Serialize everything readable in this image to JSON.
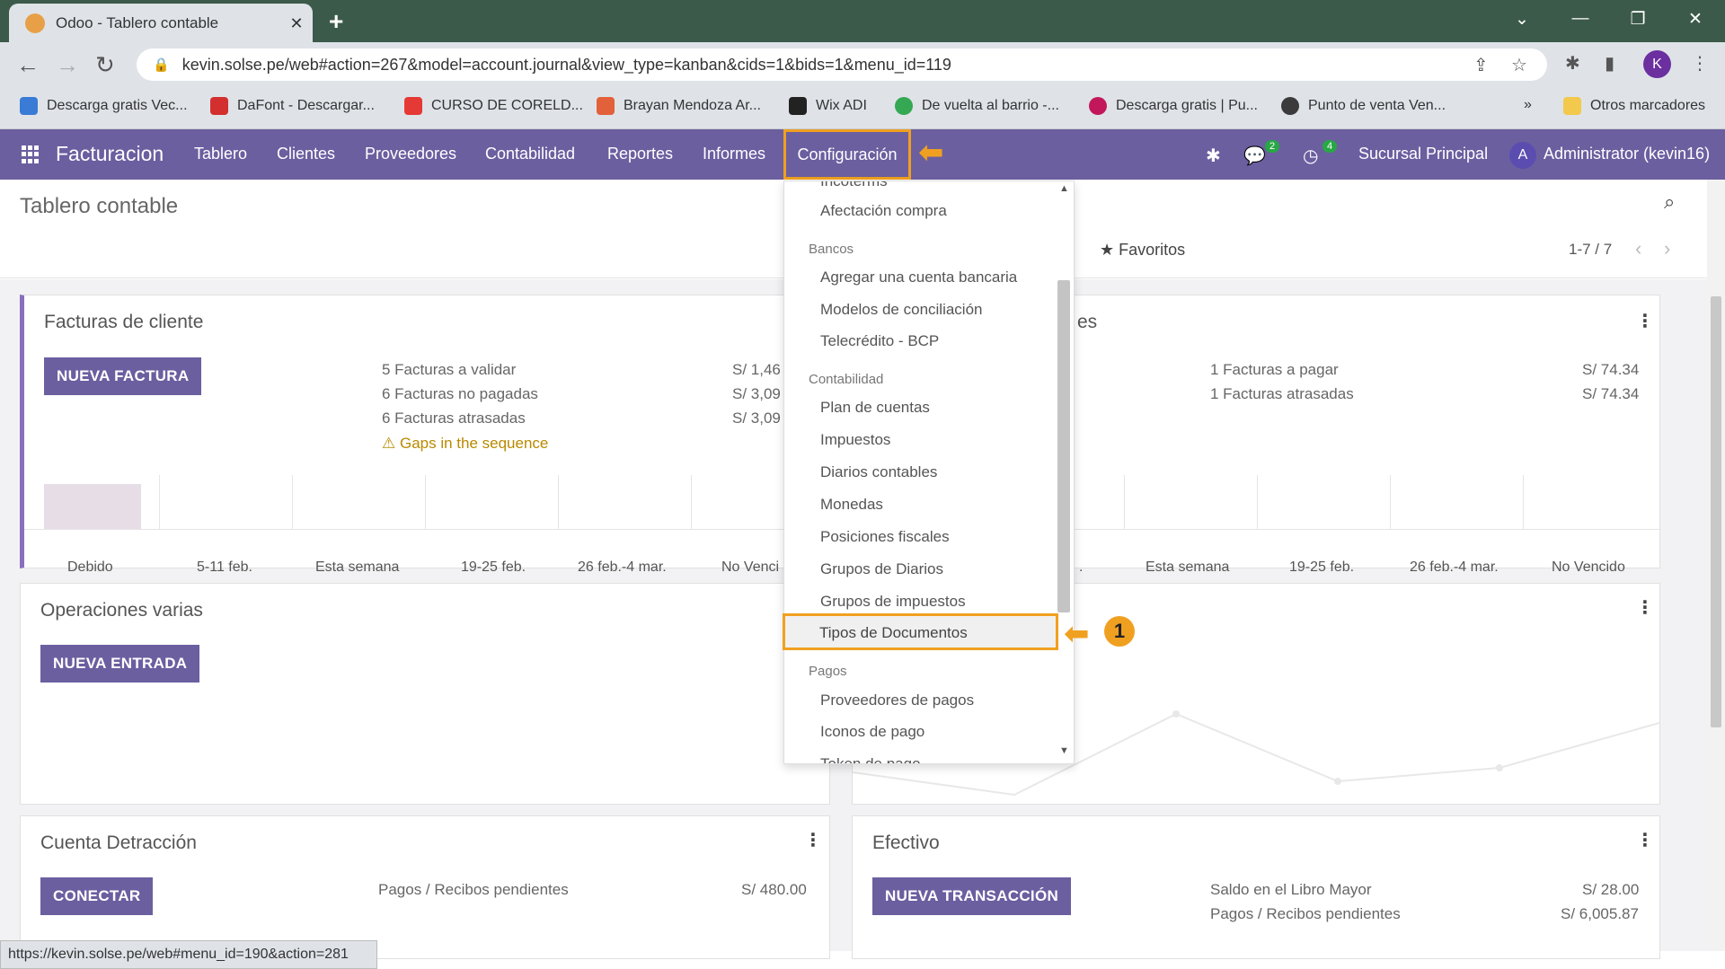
{
  "browser": {
    "tab_title": "Odoo - Tablero contable",
    "tab_close": "✕",
    "new_tab": "+",
    "url": "kevin.solse.pe/web#action=267&model=account.journal&view_type=kanban&cids=1&bids=1&menu_id=119",
    "profile_initial": "K",
    "bookmarks": [
      "Descarga gratis Vec...",
      "DaFont - Descargar...",
      "CURSO DE CORELD...",
      "Brayan Mendoza Ar...",
      "Wix ADI",
      "De vuelta al barrio -...",
      "Descarga gratis | Pu...",
      "Punto de venta Ven..."
    ],
    "bookmarks_more": "»",
    "other_bookmarks": "Otros marcadores",
    "status_url": "https://kevin.solse.pe/web#menu_id=190&action=281"
  },
  "topnav": {
    "brand": "Facturacion",
    "items": [
      "Tablero",
      "Clientes",
      "Proveedores",
      "Contabilidad",
      "Reportes",
      "Informes"
    ],
    "config": "Configuración",
    "messages_count": "2",
    "activities_count": "4",
    "branch": "Sucursal Principal",
    "user_initial": "A",
    "user": "Administrator (kevin16)"
  },
  "control": {
    "breadcrumb": "Tablero contable",
    "favorites": "Favoritos",
    "pager": "1-7 / 7"
  },
  "cards": {
    "facturas": {
      "title": "Facturas de cliente",
      "button": "NUEVA FACTURA",
      "stats": [
        {
          "label": "5 Facturas a validar",
          "value": "S/ 1,46"
        },
        {
          "label": "6 Facturas no pagadas",
          "value": "S/ 3,09"
        },
        {
          "label": "6 Facturas atrasadas",
          "value": "S/ 3,09"
        }
      ],
      "warning": "Gaps in the sequence",
      "graph_labels": [
        "Debido",
        "5-11 feb.",
        "Esta semana",
        "19-25 feb.",
        "26 feb.-4 mar.",
        "No Venci"
      ]
    },
    "proveedores": {
      "title_partial": "es",
      "stats": [
        {
          "label": "1 Facturas a pagar",
          "value": "S/ 74.34"
        },
        {
          "label": "1 Facturas atrasadas",
          "value": "S/ 74.34"
        }
      ],
      "graph_labels": [
        ".",
        "Esta semana",
        "19-25 feb.",
        "26 feb.-4 mar.",
        "No Vencido"
      ]
    },
    "operaciones": {
      "title": "Operaciones varias",
      "button": "NUEVA ENTRADA"
    },
    "detraccion": {
      "title": "Cuenta Detracción",
      "button": "CONECTAR",
      "stat": {
        "label": "Pagos / Recibos pendientes",
        "value": "S/ 480.00"
      }
    },
    "efectivo": {
      "title": "Efectivo",
      "button": "NUEVA TRANSACCIÓN",
      "stats": [
        {
          "label": "Saldo en el Libro Mayor",
          "value": "S/ 28.00"
        },
        {
          "label": "Pagos / Recibos pendientes",
          "value": "S/ 6,005.87"
        }
      ]
    }
  },
  "dropdown": {
    "cut_top": "Incoterms",
    "afectacion": "Afectación compra",
    "bancos_head": "Bancos",
    "bancos": [
      "Agregar una cuenta bancaria",
      "Modelos de conciliación",
      "Telecrédito - BCP"
    ],
    "contabilidad_head": "Contabilidad",
    "contabilidad": [
      "Plan de cuentas",
      "Impuestos",
      "Diarios contables",
      "Monedas",
      "Posiciones fiscales",
      "Grupos de Diarios",
      "Grupos de impuestos"
    ],
    "highlighted": "Tipos de Documentos",
    "pagos_head": "Pagos",
    "pagos": [
      "Proveedores de pagos",
      "Iconos de pago"
    ],
    "cut_bottom": "Token de pago"
  },
  "annotation": {
    "step": "1"
  }
}
